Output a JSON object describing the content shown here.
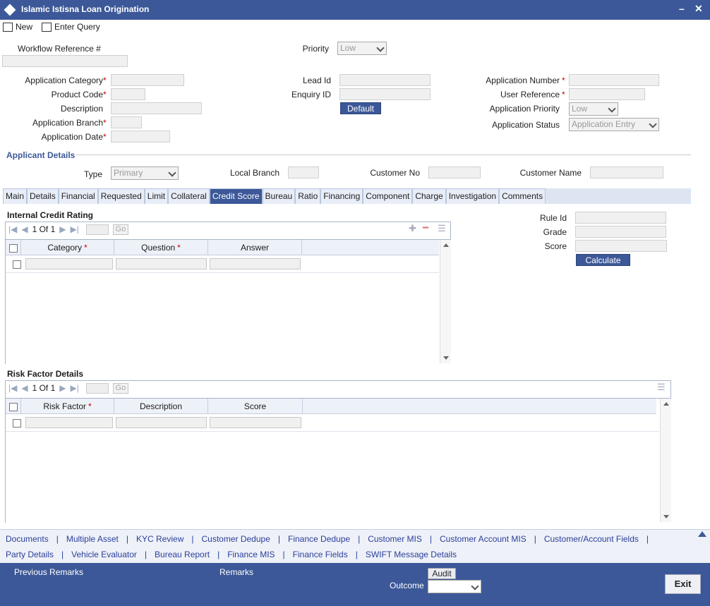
{
  "window": {
    "title": "Islamic Istisna Loan Origination",
    "min": "–",
    "close": "✕"
  },
  "toolbar": {
    "new_label": "New",
    "enter_query_label": "Enter Query"
  },
  "header": {
    "workflow_ref_label": "Workflow Reference #",
    "priority_label": "Priority",
    "priority_value": "Low"
  },
  "form": {
    "app_category_label": "Application Category",
    "product_code_label": "Product Code",
    "description_label": "Description",
    "app_branch_label": "Application Branch",
    "app_date_label": "Application Date",
    "lead_id_label": "Lead Id",
    "enquiry_id_label": "Enquiry ID",
    "default_btn": "Default",
    "app_number_label": "Application Number",
    "user_ref_label": "User Reference",
    "app_priority_label": "Application Priority",
    "app_priority_value": "Low",
    "app_status_label": "Application Status",
    "app_status_value": "Application Entry",
    "req": "*"
  },
  "applicant": {
    "title": "Applicant Details",
    "type_label": "Type",
    "type_value": "Primary",
    "local_branch_label": "Local Branch",
    "customer_no_label": "Customer No",
    "customer_name_label": "Customer Name"
  },
  "tabs": [
    "Main",
    "Details",
    "Financial",
    "Requested",
    "Limit",
    "Collateral",
    "Credit Score",
    "Bureau",
    "Ratio",
    "Financing",
    "Component",
    "Charge",
    "Investigation",
    "Comments"
  ],
  "active_tab": "Credit Score",
  "credit_rating": {
    "title": "Internal Credit Rating",
    "page": "1 Of 1",
    "go": "Go",
    "columns": [
      "Category",
      "Question",
      "Answer"
    ]
  },
  "score_panel": {
    "rule_id_label": "Rule Id",
    "grade_label": "Grade",
    "score_label": "Score",
    "calculate_btn": "Calculate"
  },
  "risk_factor": {
    "title": "Risk Factor Details",
    "page": "1 Of 1",
    "go": "Go",
    "columns": [
      "Risk Factor",
      "Description",
      "Score"
    ]
  },
  "links_row1": [
    "Documents",
    "Multiple Asset",
    "KYC Review",
    "Customer Dedupe",
    "Finance Dedupe",
    "Customer MIS",
    "Customer Account MIS",
    "Customer/Account Fields"
  ],
  "links_row2": [
    "Party Details",
    "Vehicle Evaluator",
    "Bureau Report",
    "Finance MIS",
    "Finance Fields",
    "SWIFT Message Details"
  ],
  "footer": {
    "previous_remarks": "Previous Remarks",
    "remarks": "Remarks",
    "audit": "Audit",
    "outcome": "Outcome",
    "exit": "Exit"
  },
  "colors": {
    "primary": "#3c5898",
    "required": "#cc0000",
    "link": "#2b3f9a"
  }
}
